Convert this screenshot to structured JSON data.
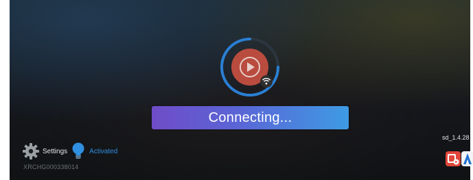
{
  "status": {
    "connecting_label": "Connecting..."
  },
  "bottom_left": {
    "settings_label": "Settings",
    "activation_status": "Activated",
    "device_id": "XRCHG000338014"
  },
  "version": "sd_1.4.28",
  "icons": {
    "player": "play-icon",
    "wifi": "wifi-icon",
    "settings": "gear-icon",
    "activation": "lightbulb-icon",
    "app_red": "app-icon-red",
    "app_blue": "app-icon-blue"
  },
  "colors": {
    "accent_blue": "#2f8fe0",
    "player_red": "#b94c3e",
    "bar_start": "#6f4cc8",
    "bar_end": "#3e9be4"
  }
}
